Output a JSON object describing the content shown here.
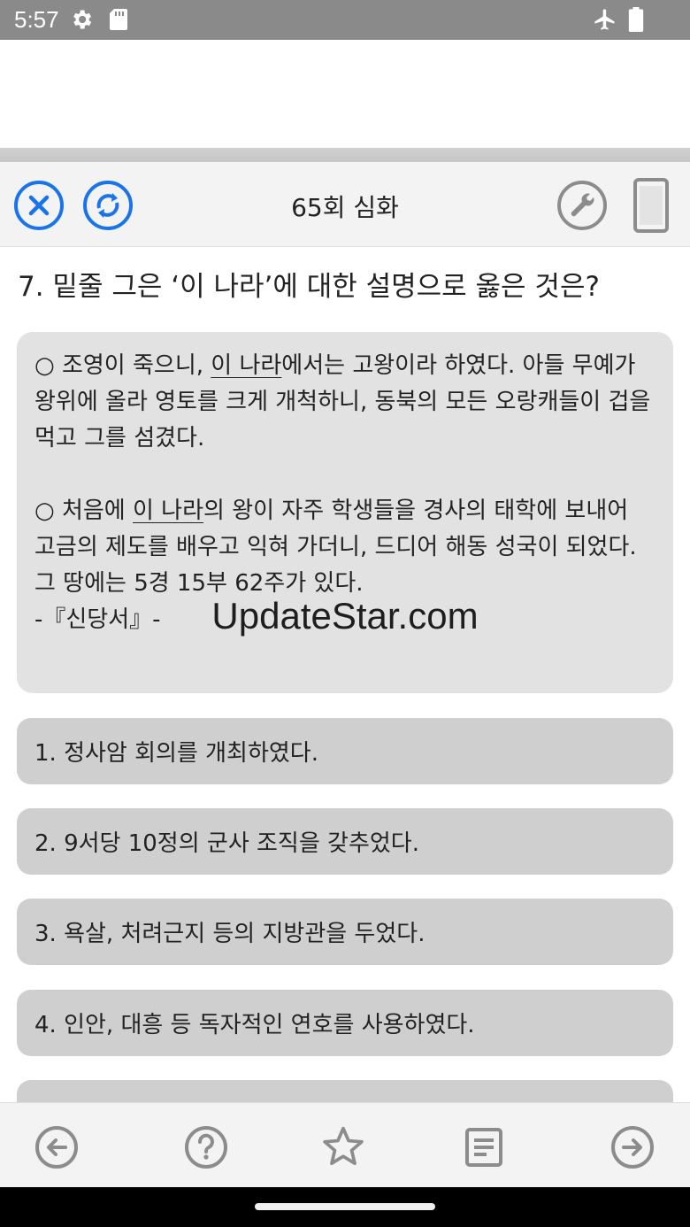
{
  "status_bar": {
    "time": "5:57",
    "icons": [
      "settings-icon",
      "sd-card-icon",
      "airplane-mode-icon",
      "battery-icon"
    ]
  },
  "toolbar": {
    "title": "65회 심화",
    "icons": [
      "close-icon",
      "refresh-icon",
      "wrench-icon",
      "phone-icon"
    ],
    "accent_color": "#1a73e8",
    "gray_icon_color": "#8c8c8c"
  },
  "question": {
    "text": "7. 밑줄 그은 ‘이 나라’에 대한 설명으로 옳은 것은?"
  },
  "passage": {
    "p1_pre": "○ 조영이 죽으니, ",
    "p1_underline": "이 나라",
    "p1_post": "에서는 고왕이라 하였다. 아들 무예가 왕위에 올라 영토를 크게 개척하니, 동북의 모든 오랑캐들이 겁을 먹고 그를 섬겼다.",
    "p2_pre": "○ 처음에 ",
    "p2_underline": "이 나라",
    "p2_post": "의 왕이 자주 학생들을 경사의 태학에 보내어 고금의 제도를 배우고 익혀 가더니, 드디어 해동 성국이 되었다. 그 땅에는 5경 15부 62주가 있다.",
    "source": "-『신당서』-"
  },
  "watermark": "UpdateStar.com",
  "options": [
    {
      "label": "1. 정사암 회의를 개최하였다."
    },
    {
      "label": "2. 9서당 10정의 군사 조직을 갖추었다."
    },
    {
      "label": "3. 욕살, 처려근지 등의 지방관을 두었다."
    },
    {
      "label": "4. 인안, 대흥 등 독자적인 연호를 사용하였다."
    }
  ],
  "bottom_nav": {
    "icons": [
      "back-arrow-icon",
      "help-icon",
      "star-icon",
      "notes-icon",
      "forward-arrow-icon"
    ]
  }
}
